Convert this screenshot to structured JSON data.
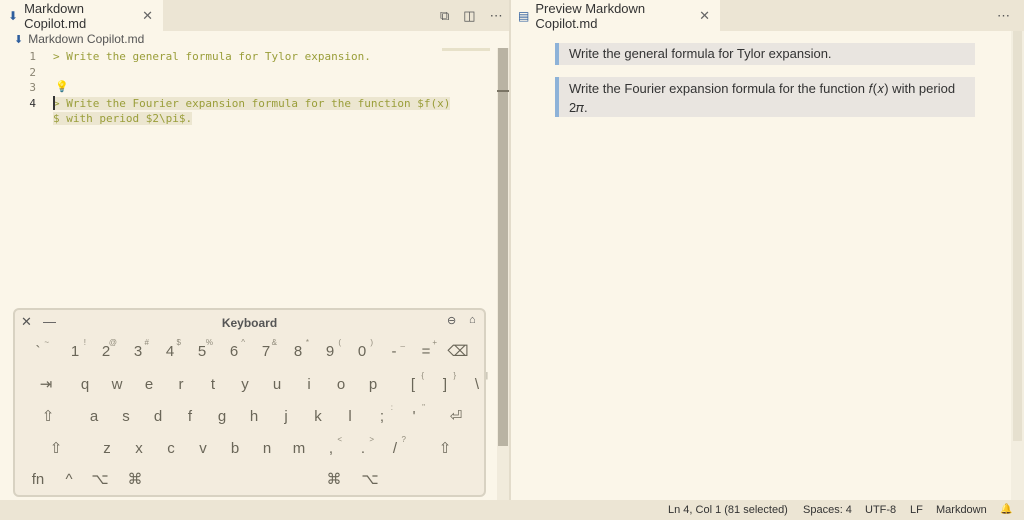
{
  "left_tab": {
    "title": "Markdown Copilot.md",
    "close": "✕"
  },
  "left_actions": [
    "⧉",
    "◫",
    "⋯"
  ],
  "breadcrumb": {
    "file": "Markdown Copilot.md"
  },
  "editor": {
    "line_numbers": [
      "1",
      "2",
      "3",
      "4"
    ],
    "lines": [
      "> Write the general formula for Tylor expansion.",
      "",
      "",
      "> Write the Fourier expansion formula for the function $f(x)",
      "$ with period $2\\pi$."
    ]
  },
  "right_tab": {
    "title": "Preview Markdown Copilot.md",
    "close": "✕"
  },
  "right_actions": [
    "⋯"
  ],
  "preview": {
    "quote1": "Write the general formula for Tylor expansion.",
    "quote2_line1": "Write the Fourier expansion formula for the function 𝑓(𝑥) with period",
    "quote2_line2": "2𝜋."
  },
  "statusbar": {
    "position": "Ln 4, Col 1 (81 selected)",
    "spaces": "Spaces: 4",
    "encoding": "UTF-8",
    "eol": "LF",
    "language": "Markdown",
    "bell": "🔔"
  },
  "keyboard": {
    "title": "Keyboard",
    "close": "✕",
    "minimize": "—",
    "row1": [
      [
        "`",
        "~"
      ],
      [
        "1",
        "!"
      ],
      [
        "2",
        "@"
      ],
      [
        "3",
        "#"
      ],
      [
        "4",
        "$"
      ],
      [
        "5",
        "%"
      ],
      [
        "6",
        "^"
      ],
      [
        "7",
        "&"
      ],
      [
        "8",
        "*"
      ],
      [
        "9",
        "("
      ],
      [
        "0",
        ")"
      ],
      [
        "-",
        "_"
      ],
      [
        "=",
        "+"
      ],
      [
        "⌫",
        ""
      ]
    ],
    "row2": [
      [
        "⇥",
        ""
      ],
      [
        "q",
        ""
      ],
      [
        "w",
        ""
      ],
      [
        "e",
        ""
      ],
      [
        "r",
        ""
      ],
      [
        "t",
        ""
      ],
      [
        "y",
        ""
      ],
      [
        "u",
        ""
      ],
      [
        "i",
        ""
      ],
      [
        "o",
        ""
      ],
      [
        "p",
        ""
      ],
      [
        "[",
        "{"
      ],
      [
        "]",
        "}"
      ],
      [
        "\\",
        "|"
      ]
    ],
    "row3": [
      [
        "⇧",
        ""
      ],
      [
        "a",
        ""
      ],
      [
        "s",
        ""
      ],
      [
        "d",
        ""
      ],
      [
        "f",
        ""
      ],
      [
        "g",
        ""
      ],
      [
        "h",
        ""
      ],
      [
        "j",
        ""
      ],
      [
        "k",
        ""
      ],
      [
        "l",
        ""
      ],
      [
        ";",
        ":"
      ],
      [
        "'",
        "\""
      ],
      [
        "⏎",
        ""
      ]
    ],
    "row4": [
      [
        "⇧",
        ""
      ],
      [
        "z",
        ""
      ],
      [
        "x",
        ""
      ],
      [
        "c",
        ""
      ],
      [
        "v",
        ""
      ],
      [
        "b",
        ""
      ],
      [
        "n",
        ""
      ],
      [
        "m",
        ""
      ],
      [
        ",",
        "<"
      ],
      [
        ".",
        ">"
      ],
      [
        "/",
        "?"
      ],
      [
        "⇧",
        ""
      ]
    ],
    "row5": [
      [
        "fn",
        ""
      ],
      [
        "^",
        ""
      ],
      [
        "⌥",
        ""
      ],
      [
        "⌘",
        ""
      ],
      [
        "⌘",
        ""
      ],
      [
        "⌥",
        ""
      ]
    ]
  }
}
